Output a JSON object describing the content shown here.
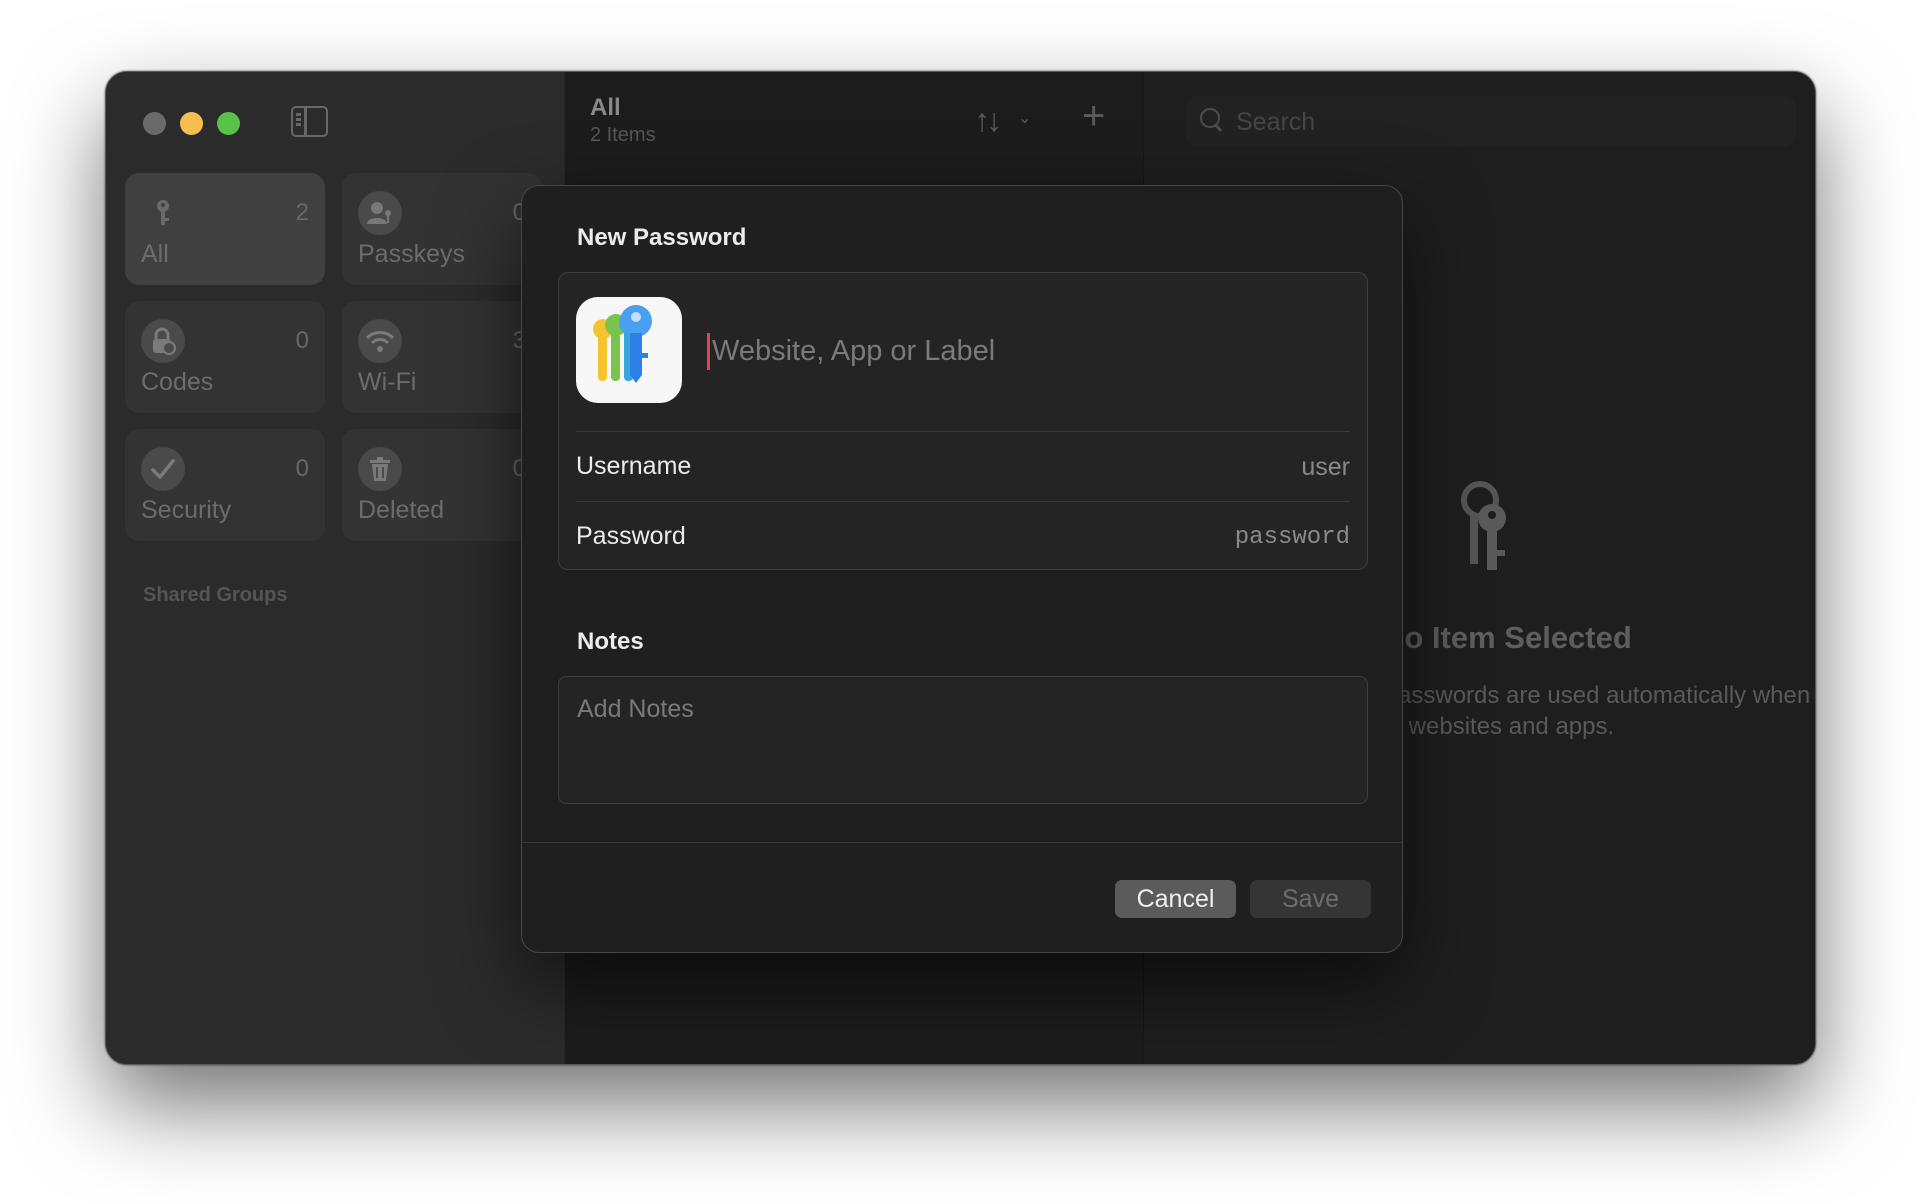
{
  "sidebar": {
    "tiles": [
      {
        "label": "All",
        "count": "2",
        "icon": "key-icon"
      },
      {
        "label": "Passkeys",
        "count": "0",
        "icon": "person-key-icon"
      },
      {
        "label": "Codes",
        "count": "0",
        "icon": "lock-clock-icon"
      },
      {
        "label": "Wi-Fi",
        "count": "3",
        "icon": "wifi-icon"
      },
      {
        "label": "Security",
        "count": "0",
        "icon": "checkmark-icon"
      },
      {
        "label": "Deleted",
        "count": "0",
        "icon": "trash-icon"
      }
    ],
    "shared_groups_label": "Shared Groups"
  },
  "list": {
    "title": "All",
    "count_label": "2 Items"
  },
  "detail": {
    "search_placeholder": "Search",
    "empty_title": "No Item Selected",
    "empty_subtitle_line1": "Passwords are used automatically when signing in",
    "empty_subtitle_line2": "to websites and apps."
  },
  "dialog": {
    "title": "New Password",
    "site_placeholder": "Website, App or Label",
    "username_label": "Username",
    "username_placeholder": "user",
    "password_label": "Password",
    "password_placeholder": "password",
    "notes_label": "Notes",
    "notes_placeholder": "Add Notes",
    "cancel_label": "Cancel",
    "save_label": "Save"
  },
  "colors": {
    "traffic_yellow": "#f5bf4f",
    "traffic_green": "#5ac14a",
    "caret": "#e0454f"
  }
}
